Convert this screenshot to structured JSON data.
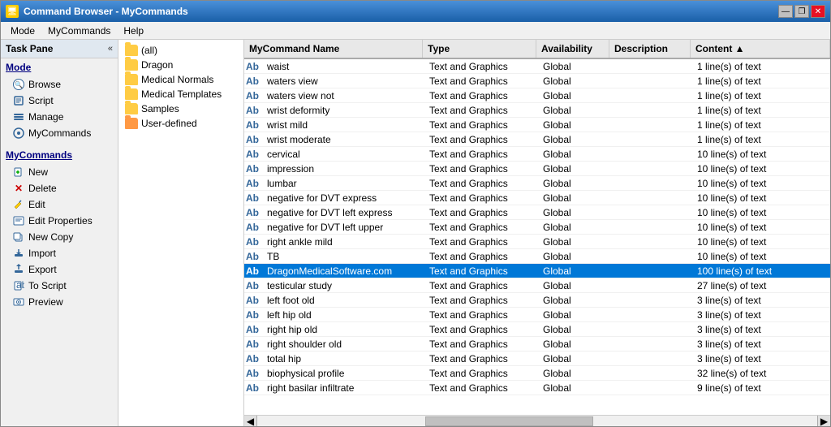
{
  "window": {
    "title": "Command Browser - MyCommands",
    "controls": {
      "minimize": "—",
      "maximize": "❐",
      "close": "✕"
    }
  },
  "menu": {
    "items": [
      "Mode",
      "MyCommands",
      "Help"
    ]
  },
  "taskPane": {
    "title": "Task Pane",
    "collapse": "«"
  },
  "modeSection": {
    "label": "Mode",
    "items": [
      {
        "id": "browse",
        "label": "Browse",
        "icon": "magnify"
      },
      {
        "id": "script",
        "label": "Script",
        "icon": "script"
      },
      {
        "id": "manage",
        "label": "Manage",
        "icon": "manage"
      },
      {
        "id": "mycommands",
        "label": "MyCommands",
        "icon": "gear"
      }
    ]
  },
  "myCommandsSection": {
    "label": "MyCommands",
    "items": [
      {
        "id": "new",
        "label": "New",
        "icon": "new"
      },
      {
        "id": "delete",
        "label": "Delete",
        "icon": "delete"
      },
      {
        "id": "edit",
        "label": "Edit",
        "icon": "edit"
      },
      {
        "id": "edit-properties",
        "label": "Edit Properties",
        "icon": "properties"
      },
      {
        "id": "new-copy",
        "label": "New Copy",
        "icon": "copy"
      },
      {
        "id": "import",
        "label": "Import",
        "icon": "import"
      },
      {
        "id": "export",
        "label": "Export",
        "icon": "export"
      },
      {
        "id": "to-script",
        "label": "To Script",
        "icon": "toscript"
      },
      {
        "id": "preview",
        "label": "Preview",
        "icon": "preview"
      }
    ]
  },
  "folders": [
    {
      "id": "all",
      "label": "(all)",
      "type": "folder"
    },
    {
      "id": "dragon",
      "label": "Dragon",
      "type": "folder"
    },
    {
      "id": "medical-normals",
      "label": "Medical Normals",
      "type": "folder"
    },
    {
      "id": "medical-templates",
      "label": "Medical Templates",
      "type": "folder"
    },
    {
      "id": "samples",
      "label": "Samples",
      "type": "folder"
    },
    {
      "id": "user-defined",
      "label": "User-defined",
      "type": "folder-special"
    }
  ],
  "table": {
    "headers": [
      {
        "id": "name",
        "label": "MyCommand Name"
      },
      {
        "id": "type",
        "label": "Type"
      },
      {
        "id": "availability",
        "label": "Availability"
      },
      {
        "id": "description",
        "label": "Description"
      },
      {
        "id": "content",
        "label": "Content"
      }
    ],
    "rows": [
      {
        "name": "waist",
        "type": "Text and Graphics",
        "availability": "Global",
        "description": "",
        "content": "1 line(s) of text",
        "selected": false
      },
      {
        "name": "waters view",
        "type": "Text and Graphics",
        "availability": "Global",
        "description": "",
        "content": "1 line(s) of text",
        "selected": false
      },
      {
        "name": "waters view not",
        "type": "Text and Graphics",
        "availability": "Global",
        "description": "",
        "content": "1 line(s) of text",
        "selected": false
      },
      {
        "name": "wrist deformity",
        "type": "Text and Graphics",
        "availability": "Global",
        "description": "",
        "content": "1 line(s) of text",
        "selected": false
      },
      {
        "name": "wrist mild",
        "type": "Text and Graphics",
        "availability": "Global",
        "description": "",
        "content": "1 line(s) of text",
        "selected": false
      },
      {
        "name": "wrist moderate",
        "type": "Text and Graphics",
        "availability": "Global",
        "description": "",
        "content": "1 line(s) of text",
        "selected": false
      },
      {
        "name": "cervical",
        "type": "Text and Graphics",
        "availability": "Global",
        "description": "",
        "content": "10 line(s) of text",
        "selected": false
      },
      {
        "name": "impression",
        "type": "Text and Graphics",
        "availability": "Global",
        "description": "",
        "content": "10 line(s) of text",
        "selected": false
      },
      {
        "name": "lumbar",
        "type": "Text and Graphics",
        "availability": "Global",
        "description": "",
        "content": "10 line(s) of text",
        "selected": false
      },
      {
        "name": "negative for DVT express",
        "type": "Text and Graphics",
        "availability": "Global",
        "description": "",
        "content": "10 line(s) of text",
        "selected": false
      },
      {
        "name": "negative for DVT left express",
        "type": "Text and Graphics",
        "availability": "Global",
        "description": "",
        "content": "10 line(s) of text",
        "selected": false
      },
      {
        "name": "negative for DVT left upper",
        "type": "Text and Graphics",
        "availability": "Global",
        "description": "",
        "content": "10 line(s) of text",
        "selected": false
      },
      {
        "name": "right ankle mild",
        "type": "Text and Graphics",
        "availability": "Global",
        "description": "",
        "content": "10 line(s) of text",
        "selected": false
      },
      {
        "name": "TB",
        "type": "Text and Graphics",
        "availability": "Global",
        "description": "",
        "content": "10 line(s) of text",
        "selected": false
      },
      {
        "name": "DragonMedicalSoftware.com",
        "type": "Text and Graphics",
        "availability": "Global",
        "description": "",
        "content": "100 line(s) of text",
        "selected": true
      },
      {
        "name": "testicular study",
        "type": "Text and Graphics",
        "availability": "Global",
        "description": "",
        "content": "27 line(s) of text",
        "selected": false
      },
      {
        "name": "left foot old",
        "type": "Text and Graphics",
        "availability": "Global",
        "description": "",
        "content": "3 line(s) of text",
        "selected": false
      },
      {
        "name": "left hip old",
        "type": "Text and Graphics",
        "availability": "Global",
        "description": "",
        "content": "3 line(s) of text",
        "selected": false
      },
      {
        "name": "right hip old",
        "type": "Text and Graphics",
        "availability": "Global",
        "description": "",
        "content": "3 line(s) of text",
        "selected": false
      },
      {
        "name": "right shoulder old",
        "type": "Text and Graphics",
        "availability": "Global",
        "description": "",
        "content": "3 line(s) of text",
        "selected": false
      },
      {
        "name": "total hip",
        "type": "Text and Graphics",
        "availability": "Global",
        "description": "",
        "content": "3 line(s) of text",
        "selected": false
      },
      {
        "name": "biophysical profile",
        "type": "Text and Graphics",
        "availability": "Global",
        "description": "",
        "content": "32 line(s) of text",
        "selected": false
      },
      {
        "name": "right basilar infiltrate",
        "type": "Text and Graphics",
        "availability": "Global",
        "description": "",
        "content": "9 line(s) of text",
        "selected": false
      }
    ]
  },
  "colors": {
    "selectedRow": "#0078d7",
    "selectedText": "#0055aa",
    "headerBg": "#e8e8e8",
    "folderYellow": "#ffcc44",
    "folderOrange": "#ff9944"
  }
}
